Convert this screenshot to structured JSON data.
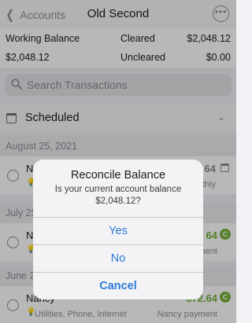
{
  "navbar": {
    "back_label": "Accounts",
    "title": "Old Second",
    "more_glyph": "•••"
  },
  "summary": {
    "working_balance_label": "Working Balance",
    "working_balance_value": "$2,048.12",
    "cleared_label": "Cleared",
    "cleared_value": "$2,048.12",
    "uncleared_label": "Uncleared",
    "uncleared_value": "$0.00"
  },
  "search": {
    "placeholder": "Search Transactions"
  },
  "scheduled": {
    "label": "Scheduled"
  },
  "sections": [
    {
      "date": "August 25, 2021"
    },
    {
      "date": "July 25"
    },
    {
      "date": "June 2"
    }
  ],
  "rows": [
    {
      "payee": "Na",
      "subtitle": "",
      "amount": "64",
      "right_sub": "thly"
    },
    {
      "payee": "Na",
      "subtitle": "",
      "amount": "64",
      "right_sub": "yment"
    },
    {
      "payee": "Nancy",
      "subtitle": "Utilities, Phone, Internet",
      "amount": "$72.64",
      "right_sub": "Nancy payment"
    }
  ],
  "alert": {
    "title": "Reconcile Balance",
    "message": "Is your current account balance $2,048.12?",
    "yes_label": "Yes",
    "no_label": "No",
    "cancel_label": "Cancel"
  },
  "colors": {
    "accent": "#2f7bd6",
    "positive": "#78b23a",
    "muted": "#8e8e93"
  }
}
